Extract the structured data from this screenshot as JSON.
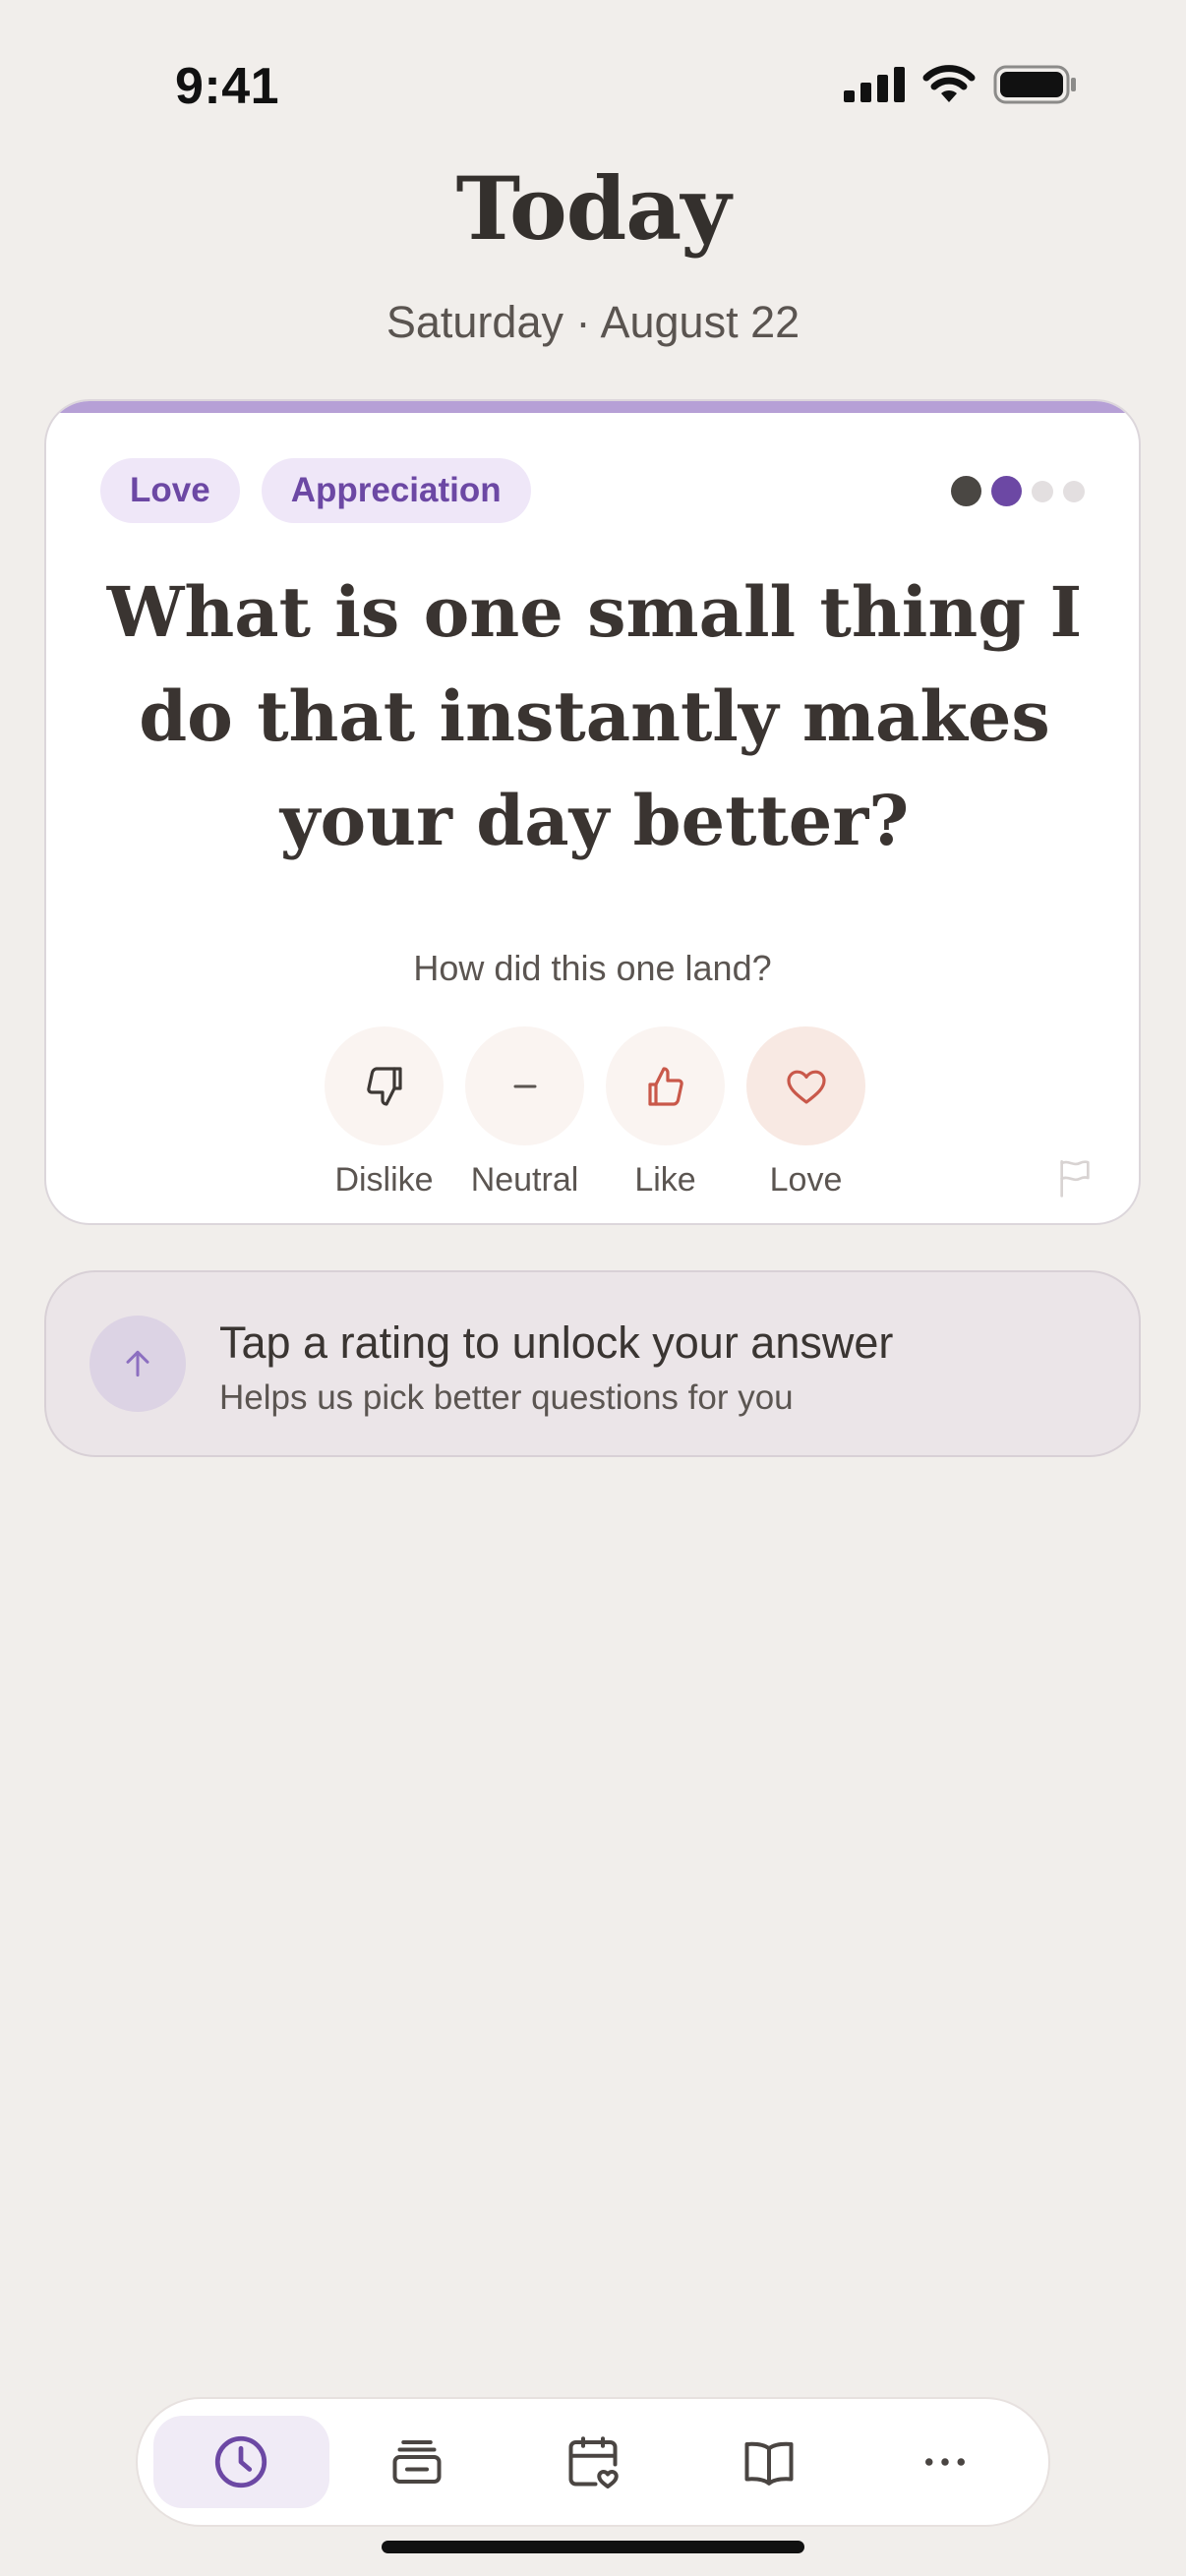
{
  "status_bar": {
    "time": "9:41"
  },
  "header": {
    "title": "Today",
    "date": "Saturday · August 22"
  },
  "card": {
    "tags": [
      "Love",
      "Appreciation"
    ],
    "progress": {
      "total": 4,
      "current": 2
    },
    "question": "What is one small thing I do that instantly makes your day better?",
    "rating_prompt": "How did this one land?",
    "ratings": [
      {
        "label": "Dislike",
        "icon": "thumbs-down-icon"
      },
      {
        "label": "Neutral",
        "icon": "minus-icon"
      },
      {
        "label": "Like",
        "icon": "thumbs-up-icon"
      },
      {
        "label": "Love",
        "icon": "heart-icon"
      }
    ],
    "flag_icon": "flag-icon"
  },
  "hint": {
    "title": "Tap a rating to unlock your answer",
    "subtitle": "Helps us pick better questions for you",
    "icon": "arrow-up-icon"
  },
  "tabbar": {
    "tabs": [
      {
        "name": "today",
        "icon": "clock-icon",
        "active": true
      },
      {
        "name": "inbox",
        "icon": "inbox-stack-icon",
        "active": false
      },
      {
        "name": "calendar",
        "icon": "calendar-heart-icon",
        "active": false
      },
      {
        "name": "journal",
        "icon": "book-icon",
        "active": false
      },
      {
        "name": "more",
        "icon": "more-dots-icon",
        "active": false
      }
    ]
  },
  "colors": {
    "background": "#f1eeeb",
    "accent_purple": "#6c48a4",
    "tag_bg": "#efe7f8",
    "like_red": "#c9584a"
  }
}
